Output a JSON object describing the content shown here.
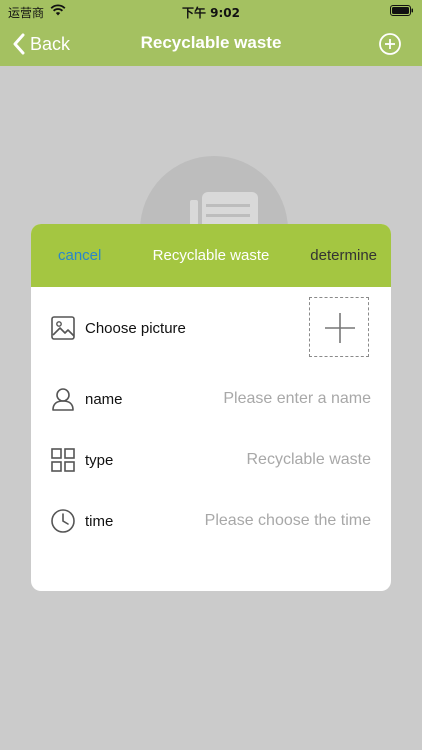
{
  "status_bar": {
    "carrier": "运营商",
    "time": "下午 9:02"
  },
  "nav": {
    "back_label": "Back",
    "title": "Recyclable waste",
    "add_icon": "plus-circle-icon"
  },
  "dialog": {
    "cancel_label": "cancel",
    "title": "Recyclable waste",
    "determine_label": "determine",
    "rows": {
      "picture": {
        "label": "Choose picture",
        "icon": "image-icon"
      },
      "name": {
        "label": "name",
        "placeholder": "Please enter a name",
        "icon": "user-icon"
      },
      "type": {
        "label": "type",
        "value": "Recyclable waste",
        "icon": "grid-icon"
      },
      "time": {
        "label": "time",
        "placeholder": "Please choose the time",
        "icon": "clock-icon"
      }
    }
  },
  "colors": {
    "header": "#a4c161",
    "dialog_header": "#a4c641",
    "cancel": "#2a86c9",
    "overlay": "#cbcbcb"
  }
}
